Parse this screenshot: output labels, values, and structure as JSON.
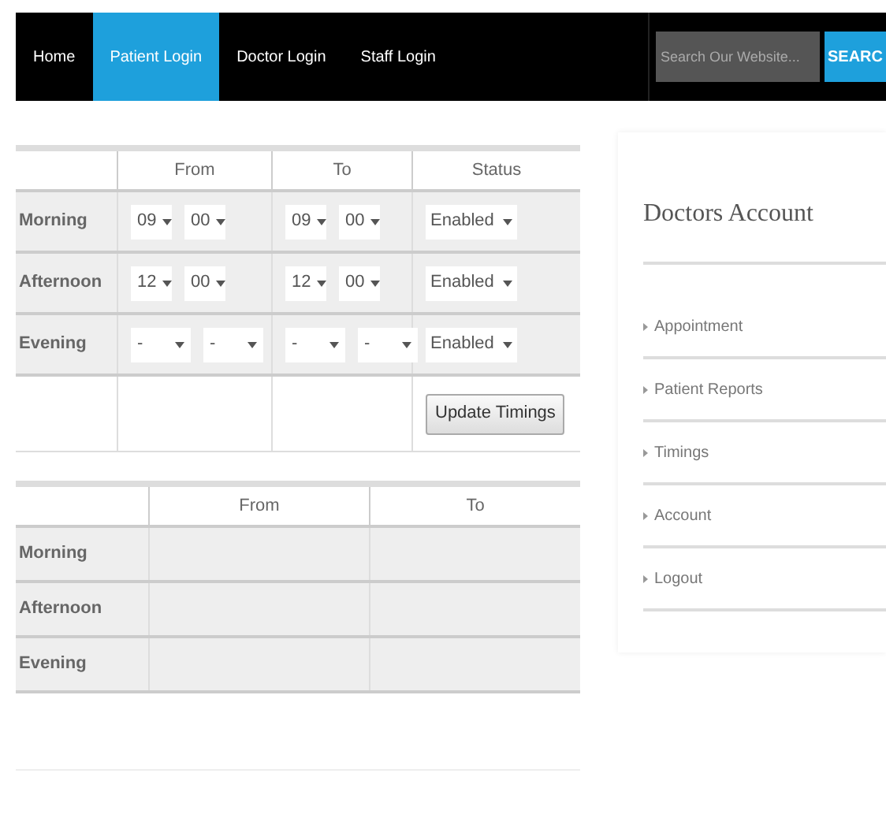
{
  "nav": {
    "items": [
      {
        "label": "Home",
        "selected": false
      },
      {
        "label": "Patient Login",
        "selected": true
      },
      {
        "label": "Doctor Login",
        "selected": false
      },
      {
        "label": "Staff Login",
        "selected": false
      }
    ],
    "search": {
      "placeholder": "Search Our Website...",
      "button": "SEARC"
    }
  },
  "timings_form": {
    "columns": [
      "From",
      "To",
      "Status"
    ],
    "rows": [
      {
        "label": "Morning",
        "from": [
          "09",
          "00"
        ],
        "to": [
          "09",
          "00"
        ],
        "status": "Enabled"
      },
      {
        "label": "Afternoon",
        "from": [
          "12",
          "00"
        ],
        "to": [
          "12",
          "00"
        ],
        "status": "Enabled"
      },
      {
        "label": "Evening",
        "from": [
          "-",
          "-"
        ],
        "to": [
          "-",
          "-"
        ],
        "status": "Enabled"
      }
    ],
    "button": "Update Timings"
  },
  "timings_table": {
    "columns": [
      "From",
      "To"
    ],
    "rows": [
      {
        "label": "Morning"
      },
      {
        "label": "Afternoon"
      },
      {
        "label": "Evening"
      }
    ]
  },
  "sidebar": {
    "title": "Doctors Account",
    "items": [
      "Appointment",
      "Patient Reports",
      "Timings",
      "Account",
      "Logout"
    ]
  }
}
